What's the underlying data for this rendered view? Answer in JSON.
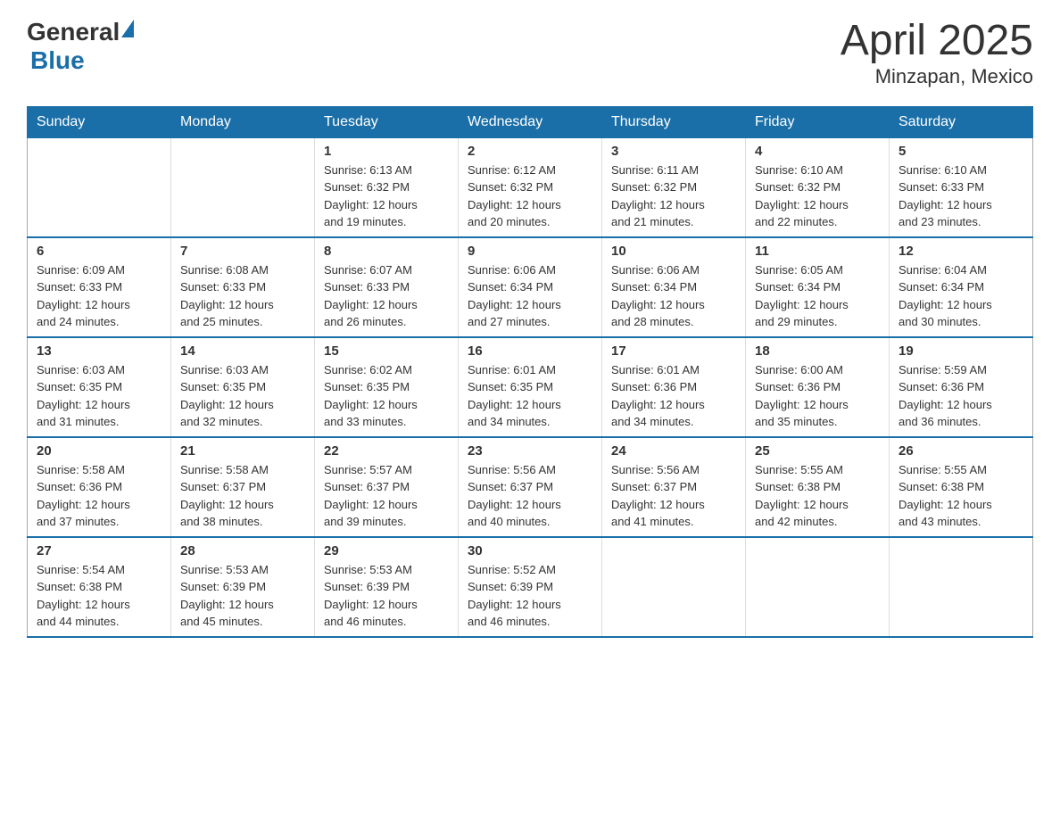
{
  "logo": {
    "general": "General",
    "blue": "Blue"
  },
  "title": "April 2025",
  "subtitle": "Minzapan, Mexico",
  "days_of_week": [
    "Sunday",
    "Monday",
    "Tuesday",
    "Wednesday",
    "Thursday",
    "Friday",
    "Saturday"
  ],
  "weeks": [
    [
      {
        "day": "",
        "info": ""
      },
      {
        "day": "",
        "info": ""
      },
      {
        "day": "1",
        "info": "Sunrise: 6:13 AM\nSunset: 6:32 PM\nDaylight: 12 hours\nand 19 minutes."
      },
      {
        "day": "2",
        "info": "Sunrise: 6:12 AM\nSunset: 6:32 PM\nDaylight: 12 hours\nand 20 minutes."
      },
      {
        "day": "3",
        "info": "Sunrise: 6:11 AM\nSunset: 6:32 PM\nDaylight: 12 hours\nand 21 minutes."
      },
      {
        "day": "4",
        "info": "Sunrise: 6:10 AM\nSunset: 6:32 PM\nDaylight: 12 hours\nand 22 minutes."
      },
      {
        "day": "5",
        "info": "Sunrise: 6:10 AM\nSunset: 6:33 PM\nDaylight: 12 hours\nand 23 minutes."
      }
    ],
    [
      {
        "day": "6",
        "info": "Sunrise: 6:09 AM\nSunset: 6:33 PM\nDaylight: 12 hours\nand 24 minutes."
      },
      {
        "day": "7",
        "info": "Sunrise: 6:08 AM\nSunset: 6:33 PM\nDaylight: 12 hours\nand 25 minutes."
      },
      {
        "day": "8",
        "info": "Sunrise: 6:07 AM\nSunset: 6:33 PM\nDaylight: 12 hours\nand 26 minutes."
      },
      {
        "day": "9",
        "info": "Sunrise: 6:06 AM\nSunset: 6:34 PM\nDaylight: 12 hours\nand 27 minutes."
      },
      {
        "day": "10",
        "info": "Sunrise: 6:06 AM\nSunset: 6:34 PM\nDaylight: 12 hours\nand 28 minutes."
      },
      {
        "day": "11",
        "info": "Sunrise: 6:05 AM\nSunset: 6:34 PM\nDaylight: 12 hours\nand 29 minutes."
      },
      {
        "day": "12",
        "info": "Sunrise: 6:04 AM\nSunset: 6:34 PM\nDaylight: 12 hours\nand 30 minutes."
      }
    ],
    [
      {
        "day": "13",
        "info": "Sunrise: 6:03 AM\nSunset: 6:35 PM\nDaylight: 12 hours\nand 31 minutes."
      },
      {
        "day": "14",
        "info": "Sunrise: 6:03 AM\nSunset: 6:35 PM\nDaylight: 12 hours\nand 32 minutes."
      },
      {
        "day": "15",
        "info": "Sunrise: 6:02 AM\nSunset: 6:35 PM\nDaylight: 12 hours\nand 33 minutes."
      },
      {
        "day": "16",
        "info": "Sunrise: 6:01 AM\nSunset: 6:35 PM\nDaylight: 12 hours\nand 34 minutes."
      },
      {
        "day": "17",
        "info": "Sunrise: 6:01 AM\nSunset: 6:36 PM\nDaylight: 12 hours\nand 34 minutes."
      },
      {
        "day": "18",
        "info": "Sunrise: 6:00 AM\nSunset: 6:36 PM\nDaylight: 12 hours\nand 35 minutes."
      },
      {
        "day": "19",
        "info": "Sunrise: 5:59 AM\nSunset: 6:36 PM\nDaylight: 12 hours\nand 36 minutes."
      }
    ],
    [
      {
        "day": "20",
        "info": "Sunrise: 5:58 AM\nSunset: 6:36 PM\nDaylight: 12 hours\nand 37 minutes."
      },
      {
        "day": "21",
        "info": "Sunrise: 5:58 AM\nSunset: 6:37 PM\nDaylight: 12 hours\nand 38 minutes."
      },
      {
        "day": "22",
        "info": "Sunrise: 5:57 AM\nSunset: 6:37 PM\nDaylight: 12 hours\nand 39 minutes."
      },
      {
        "day": "23",
        "info": "Sunrise: 5:56 AM\nSunset: 6:37 PM\nDaylight: 12 hours\nand 40 minutes."
      },
      {
        "day": "24",
        "info": "Sunrise: 5:56 AM\nSunset: 6:37 PM\nDaylight: 12 hours\nand 41 minutes."
      },
      {
        "day": "25",
        "info": "Sunrise: 5:55 AM\nSunset: 6:38 PM\nDaylight: 12 hours\nand 42 minutes."
      },
      {
        "day": "26",
        "info": "Sunrise: 5:55 AM\nSunset: 6:38 PM\nDaylight: 12 hours\nand 43 minutes."
      }
    ],
    [
      {
        "day": "27",
        "info": "Sunrise: 5:54 AM\nSunset: 6:38 PM\nDaylight: 12 hours\nand 44 minutes."
      },
      {
        "day": "28",
        "info": "Sunrise: 5:53 AM\nSunset: 6:39 PM\nDaylight: 12 hours\nand 45 minutes."
      },
      {
        "day": "29",
        "info": "Sunrise: 5:53 AM\nSunset: 6:39 PM\nDaylight: 12 hours\nand 46 minutes."
      },
      {
        "day": "30",
        "info": "Sunrise: 5:52 AM\nSunset: 6:39 PM\nDaylight: 12 hours\nand 46 minutes."
      },
      {
        "day": "",
        "info": ""
      },
      {
        "day": "",
        "info": ""
      },
      {
        "day": "",
        "info": ""
      }
    ]
  ]
}
